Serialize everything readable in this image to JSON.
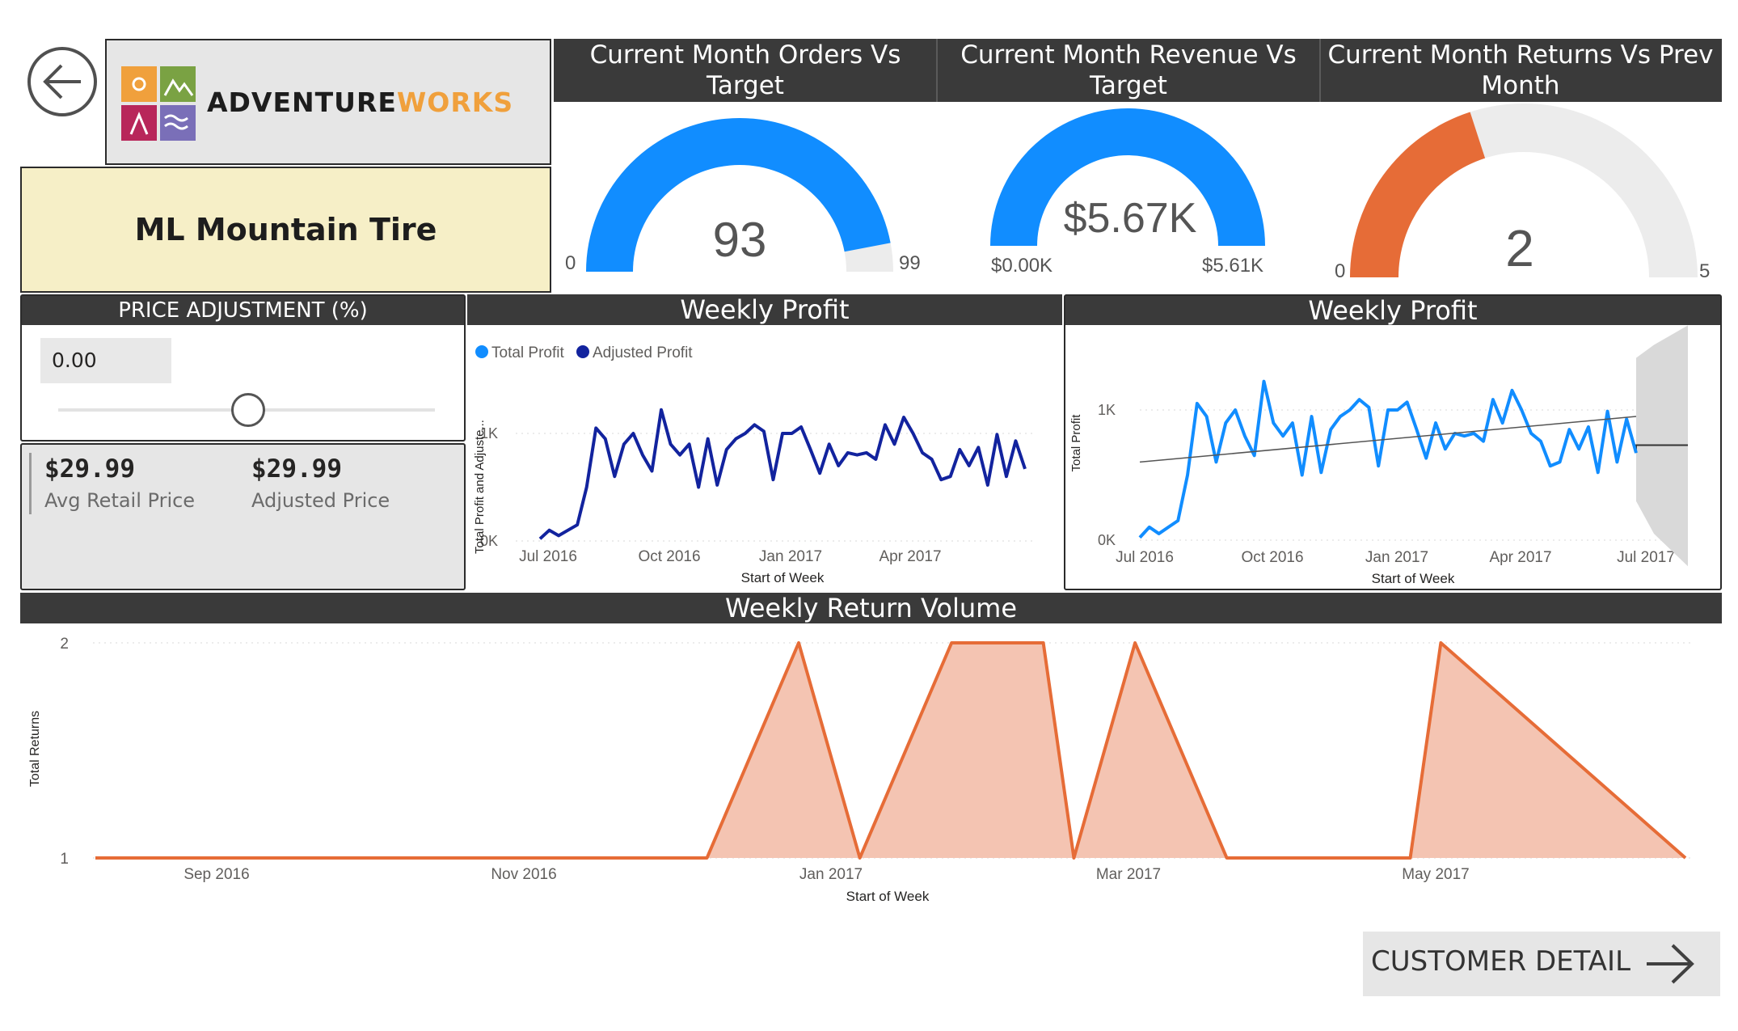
{
  "brand": {
    "logo_left": "ADVENTURE",
    "logo_right": "WORKS"
  },
  "product": {
    "name": "ML Mountain Tire"
  },
  "gauges": [
    {
      "title": "Current Month Orders Vs Target",
      "value": 93,
      "value_text": "93",
      "min": 0,
      "max": 99,
      "min_label": "0",
      "max_label": "99",
      "fill_fraction": 0.94,
      "color": "#118DFF"
    },
    {
      "title": "Current Month Revenue Vs Target",
      "value_text": "$5.67K",
      "min_label": "$0.00K",
      "max_label": "$5.61K",
      "fill_fraction": 1.0,
      "color": "#118DFF"
    },
    {
      "title": "Current Month Returns Vs Prev Month",
      "value": 2,
      "value_text": "2",
      "min": 0,
      "max": 5,
      "min_label": "0",
      "max_label": "5",
      "fill_fraction": 0.4,
      "color": "#E66C37"
    }
  ],
  "price_adjustment": {
    "title": "PRICE ADJUSTMENT (%)",
    "value": "0.00",
    "slider_fraction": 0.5
  },
  "kpis": [
    {
      "value": "$29.99",
      "label": "Avg Retail Price"
    },
    {
      "value": "$29.99",
      "label": "Adjusted Price"
    }
  ],
  "charts": {
    "weekly_profit_1": {
      "title": "Weekly Profit"
    },
    "weekly_profit_2": {
      "title": "Weekly Profit"
    },
    "weekly_returns": {
      "title": "Weekly Return Volume"
    }
  },
  "buttons": {
    "customer_detail": "CUSTOMER DETAIL"
  },
  "colors": {
    "header_bg": "#3A3A3A",
    "total_profit": "#118DFF",
    "adjusted_profit": "#12239E",
    "returns_line": "#E66C37",
    "returns_fill": "#F4C4B2",
    "product_bg": "#F6EFC7"
  },
  "chart_data": [
    {
      "type": "line",
      "title": "Weekly Profit",
      "xlabel": "Start of Week",
      "ylabel": "Total Profit and Adjuste...",
      "x_ticks": [
        "Jul 2016",
        "Oct 2016",
        "Jan 2017",
        "Apr 2017"
      ],
      "y_ticks": [
        "0K",
        "1K"
      ],
      "ylim": [
        0,
        1.5
      ],
      "legend": "top-left",
      "grid": true,
      "series": [
        {
          "name": "Total Profit",
          "color": "#118DFF",
          "values": []
        },
        {
          "name": "Adjusted Profit",
          "color": "#12239E",
          "values": [
            0.02,
            0.1,
            0.05,
            0.1,
            0.15,
            0.5,
            1.05,
            0.95,
            0.6,
            0.9,
            1.0,
            0.8,
            0.65,
            1.22,
            0.9,
            0.8,
            0.9,
            0.5,
            0.95,
            0.52,
            0.85,
            0.95,
            1.0,
            1.08,
            1.02,
            0.57,
            1.0,
            1.0,
            1.06,
            0.85,
            0.63,
            0.9,
            0.7,
            0.82,
            0.8,
            0.82,
            0.76,
            1.08,
            0.9,
            1.15,
            1.0,
            0.82,
            0.76,
            0.57,
            0.6,
            0.85,
            0.7,
            0.87,
            0.52,
            0.99,
            0.6,
            0.93,
            0.67
          ]
        }
      ]
    },
    {
      "type": "line",
      "title": "Weekly Profit",
      "xlabel": "Start of Week",
      "ylabel": "Total Profit",
      "x_ticks": [
        "Jul 2016",
        "Oct 2016",
        "Jan 2017",
        "Apr 2017",
        "Jul 2017"
      ],
      "y_ticks": [
        "0K",
        "1K"
      ],
      "ylim": [
        0,
        1.5
      ],
      "grid": true,
      "series": [
        {
          "name": "Total Profit",
          "color": "#118DFF",
          "values": [
            0.02,
            0.1,
            0.05,
            0.1,
            0.15,
            0.5,
            1.05,
            0.95,
            0.6,
            0.9,
            1.0,
            0.8,
            0.65,
            1.22,
            0.9,
            0.8,
            0.9,
            0.5,
            0.95,
            0.52,
            0.85,
            0.95,
            1.0,
            1.08,
            1.02,
            0.57,
            1.0,
            1.0,
            1.06,
            0.85,
            0.63,
            0.9,
            0.7,
            0.82,
            0.8,
            0.82,
            0.76,
            1.08,
            0.9,
            1.15,
            1.0,
            0.82,
            0.76,
            0.57,
            0.6,
            0.85,
            0.7,
            0.87,
            0.52,
            0.99,
            0.6,
            0.93,
            0.67
          ]
        },
        {
          "name": "Trend",
          "values": [
            0.6,
            0.95
          ]
        },
        {
          "name": "Forecast",
          "values": [
            0.73,
            0.73,
            0.73
          ],
          "upper": [
            1.4,
            1.5,
            1.65
          ],
          "lower": [
            0.3,
            0.05,
            -0.2
          ]
        }
      ]
    },
    {
      "type": "area",
      "title": "Weekly Return Volume",
      "xlabel": "Start of Week",
      "ylabel": "Total Returns",
      "x_ticks": [
        "Sep 2016",
        "Nov 2016",
        "Jan 2017",
        "Mar 2017",
        "May 2017"
      ],
      "y_ticks": [
        "1",
        "2"
      ],
      "ylim": [
        1,
        2
      ],
      "grid": true,
      "series": [
        {
          "name": "Total Returns",
          "color": "#E66C37",
          "x": [
            "2016-07-25",
            "2016-12-12",
            "2017-01-02",
            "2017-01-16",
            "2017-02-06",
            "2017-02-27",
            "2017-03-06",
            "2017-03-20",
            "2017-04-10",
            "2017-05-22",
            "2017-05-29",
            "2017-07-24"
          ],
          "values": [
            1,
            1,
            2,
            1,
            2,
            2,
            1,
            2,
            1,
            1,
            2,
            1
          ]
        }
      ]
    }
  ]
}
